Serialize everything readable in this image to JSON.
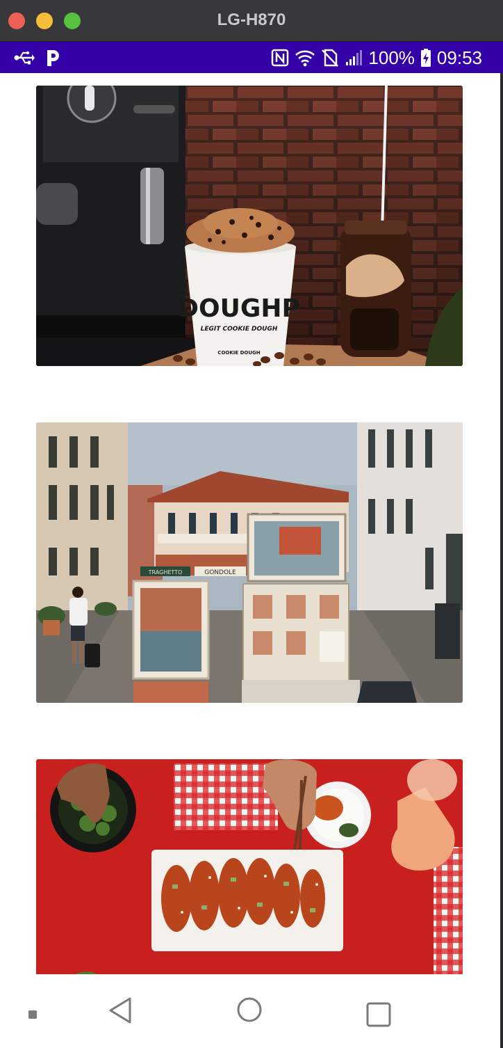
{
  "window": {
    "title": "LG-H870",
    "controls": [
      "close",
      "minimize",
      "zoom"
    ]
  },
  "status_bar": {
    "left_icons": [
      "usb-icon",
      "parking-app-icon"
    ],
    "right_icons": [
      "nfc-icon",
      "wifi-icon",
      "no-sim-icon",
      "signal-icon",
      "battery-charging-icon"
    ],
    "battery_label": "100%",
    "time": "09:53",
    "background": "#3200a6"
  },
  "feed": {
    "items": [
      {
        "name": "cookie-dough-cup-photo",
        "cup_brand": "DOUGHP",
        "cup_tagline": "LEGIT COOKIE DOUGH",
        "cup_label": "COOKIE DOUGH"
      },
      {
        "name": "venice-street-art-photo",
        "sign_left": "TRAGHETTO",
        "sign_right": "GONDOLE"
      },
      {
        "name": "korean-fried-chicken-table-photo"
      }
    ]
  },
  "nav_bar": {
    "buttons": [
      "menu-dot",
      "back",
      "home",
      "recents"
    ]
  }
}
